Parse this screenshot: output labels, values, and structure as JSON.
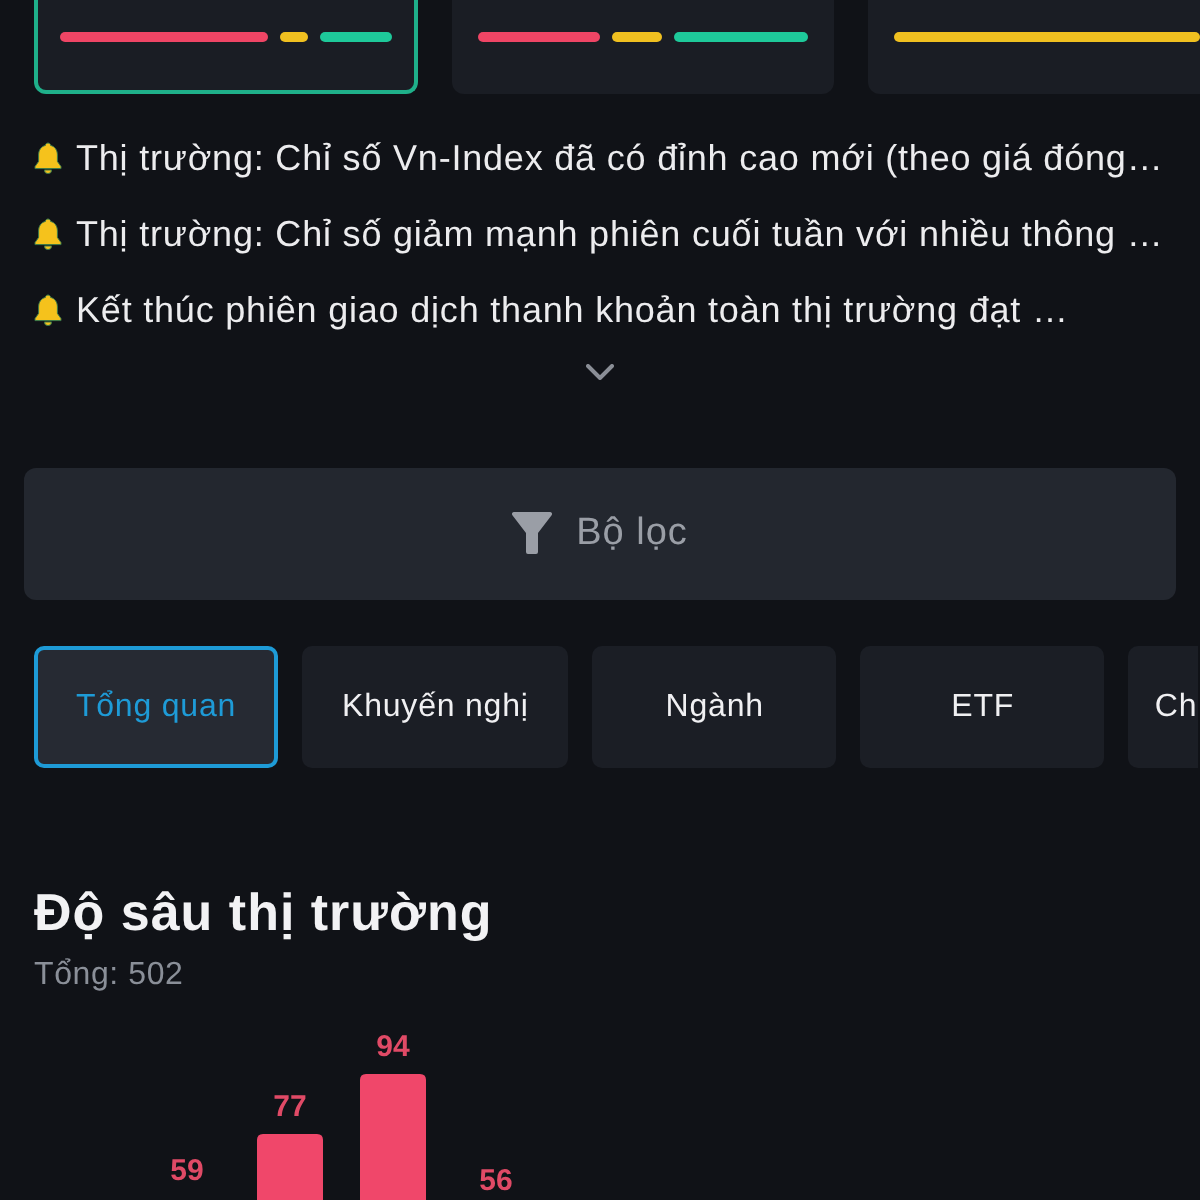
{
  "summary_cards": [
    {
      "selected": true
    },
    {
      "selected": false
    },
    {
      "selected": false
    }
  ],
  "news": [
    {
      "text": "Thị trường: Chỉ số Vn-Index đã có đỉnh cao mới (theo giá đóng…"
    },
    {
      "text": "Thị trường: Chỉ số giảm mạnh phiên cuối tuần với nhiều thông …"
    },
    {
      "text": "Kết thúc phiên giao dịch thanh khoản toàn thị trường đạt …"
    }
  ],
  "filter_button": {
    "label": "Bộ lọc"
  },
  "tabs": [
    {
      "label": "Tổng quan",
      "selected": true
    },
    {
      "label": "Khuyến nghị",
      "selected": false
    },
    {
      "label": "Ngành",
      "selected": false
    },
    {
      "label": "ETF",
      "selected": false
    },
    {
      "label": "Ch",
      "selected": false
    }
  ],
  "market_depth": {
    "title": "Độ sâu thị trường",
    "total": "Tổng: 502",
    "bar_labels": [
      {
        "text": "59"
      },
      {
        "text": "77"
      },
      {
        "text": "94"
      },
      {
        "text": "56"
      }
    ]
  }
}
